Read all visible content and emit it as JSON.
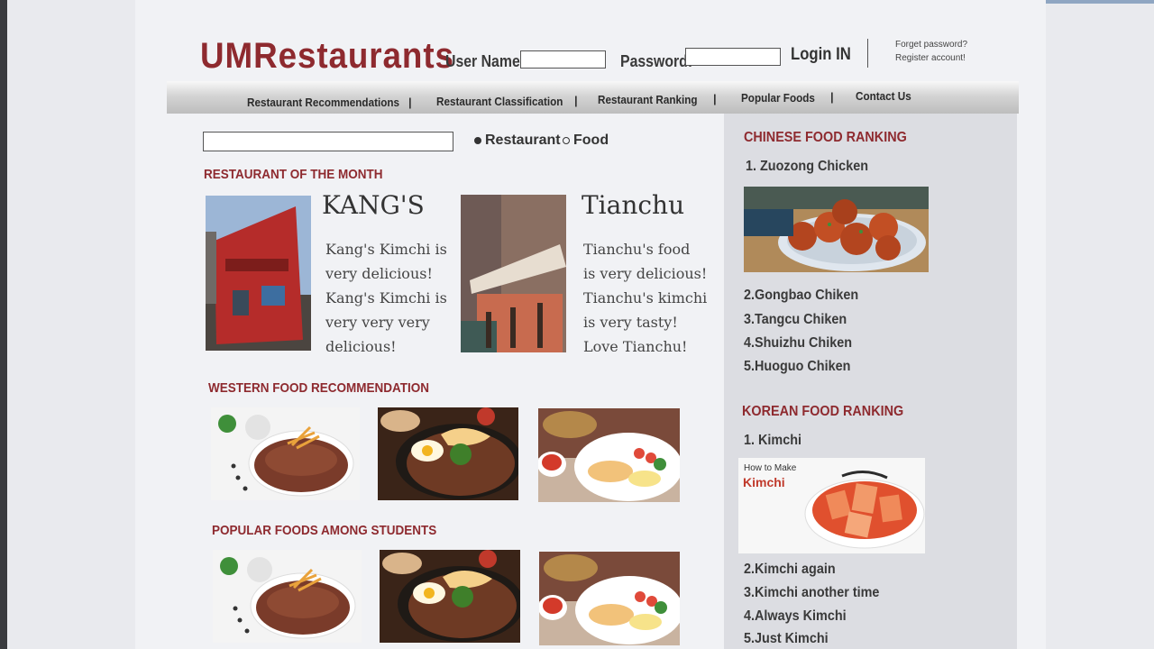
{
  "header": {
    "logo": "UMRestaurants",
    "username_label": "User Name:",
    "username_value": "",
    "password_label": "Password:",
    "password_value": "",
    "login_label": "Login IN",
    "forget_password": "Forget password?",
    "register_account": "Register account!"
  },
  "nav": {
    "items": [
      "Restaurant Recommendations",
      "Restaurant Classification",
      "Restaurant Ranking",
      "Popular Foods",
      "Contact Us"
    ],
    "separator": "|"
  },
  "search": {
    "value": "",
    "options": [
      "Restaurant",
      "Food"
    ],
    "selected": "Restaurant"
  },
  "restaurant_of_month": {
    "title": "RESTAURANT OF THE MONTH",
    "restaurants": [
      {
        "name": "KANG'S",
        "lines": [
          "Kang's Kimchi is",
          "very delicious!",
          "Kang's Kimchi is",
          "very very very",
          "delicious!"
        ]
      },
      {
        "name": "Tianchu",
        "lines": [
          "Tianchu's food",
          "is very delicious!",
          "Tianchu's kimchi",
          "is very tasty!",
          "Love Tianchu!"
        ]
      }
    ]
  },
  "western_food": {
    "title": "WESTERN FOOD RECOMMENDATION"
  },
  "popular_foods": {
    "title": "POPULAR FOODS AMONG STUDENTS"
  },
  "chinese_ranking": {
    "title": "CHINESE FOOD RANKING",
    "first": "1. Zuozong Chicken",
    "rest": [
      "2.Gongbao Chiken",
      "3.Tangcu Chiken",
      "4.Shuizhu Chiken",
      "5.Huoguo Chiken"
    ]
  },
  "korean_ranking": {
    "title": "KOREAN FOOD RANKING",
    "first": "1. Kimchi",
    "image_caption_small": "How to Make",
    "image_caption_big": "Kimchi",
    "rest": [
      "2.Kimchi again",
      "3.Kimchi another time",
      "4.Always Kimchi",
      "5.Just Kimchi"
    ]
  },
  "colors": {
    "brand": "#8e2a2f",
    "page_bg": "#f1f2f5",
    "sidebar_bg": "#dcdde2"
  },
  "icons": [
    "radio-selected-icon",
    "radio-unselected-icon"
  ]
}
